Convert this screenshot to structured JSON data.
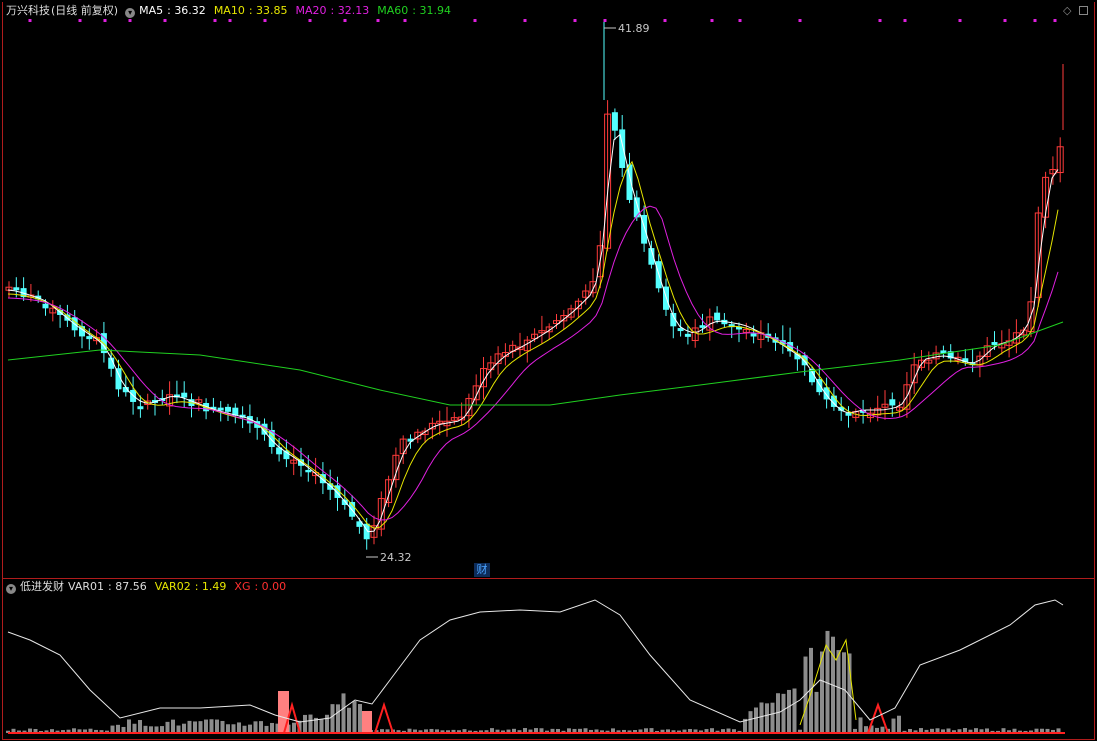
{
  "stock": {
    "title": "万兴科技",
    "period_label": "(日线 前复权)"
  },
  "ma": [
    {
      "label": "MA5",
      "value": "36.32",
      "color": "#ffffff"
    },
    {
      "label": "MA10",
      "value": "33.85",
      "color": "#e6e600"
    },
    {
      "label": "MA20",
      "value": "32.13",
      "color": "#e020e0"
    },
    {
      "label": "MA60",
      "value": "31.94",
      "color": "#20d020"
    }
  ],
  "annotations": {
    "high": "41.89",
    "low": "24.32",
    "badge": "财"
  },
  "indicator": {
    "name": "低进发财",
    "vars": [
      {
        "label": "VAR01",
        "value": "87.56",
        "color": "#dddddd"
      },
      {
        "label": "VAR02",
        "value": "1.49",
        "color": "#e6e600"
      },
      {
        "label": "XG",
        "value": "0.00",
        "color": "#ff3030"
      }
    ]
  },
  "colors": {
    "up": "#ff3b3b",
    "down": "#54ffff",
    "border": "#b01c1c",
    "dots": "#e020e0"
  }
}
